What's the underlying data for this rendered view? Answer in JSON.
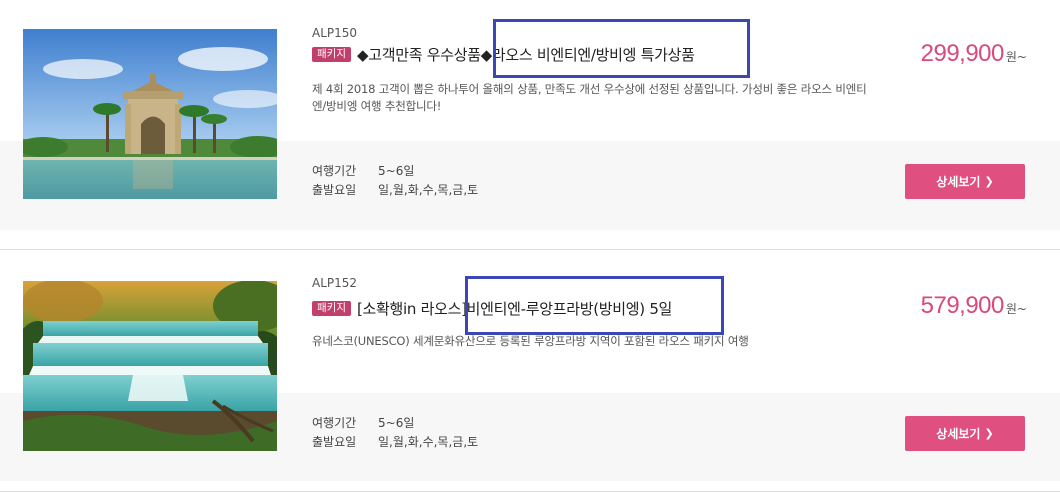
{
  "products": [
    {
      "code": "ALP150",
      "badge": "패키지",
      "title": "◆고객만족 우수상품◆라오스 비엔티엔/방비엥 특가상품",
      "description": "제 4회 2018 고객이 뽑은 하나투어 올해의 상품, 만족도 개선 우수상에 선정된 상품입니다. 가성비 좋은 라오스 비엔티엔/방비엥 여행 추천합니다!",
      "duration_label": "여행기간",
      "duration_value": "5~6일",
      "departure_label": "출발요일",
      "departure_value": "일,월,화,수,목,금,토",
      "price": "299,900",
      "price_unit": "원~",
      "button_label": "상세보기",
      "image_icon": "patuxai-monument-image"
    },
    {
      "code": "ALP152",
      "badge": "패키지",
      "title": "[소확행in 라오스]비엔티엔-루앙프라방(방비엥) 5일",
      "description": "유네스코(UNESCO) 세계문화유산으로 등록된 루앙프라방 지역이 포함된 라오스 패키지 여행",
      "duration_label": "여행기간",
      "duration_value": "5~6일",
      "departure_label": "출발요일",
      "departure_value": "일,월,화,수,목,금,토",
      "price": "579,900",
      "price_unit": "원~",
      "button_label": "상세보기",
      "image_icon": "kuang-si-waterfall-image"
    }
  ],
  "colors": {
    "price": "#d9497d",
    "button": "#df4f7f",
    "badge": "#c0406b",
    "highlight": "#3b47b5",
    "band": "#f7f7f7"
  }
}
